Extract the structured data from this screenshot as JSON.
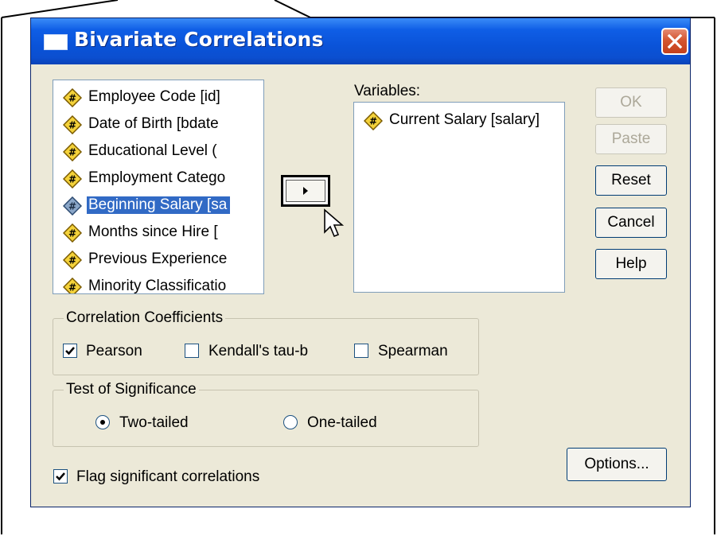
{
  "dialog": {
    "title": "Bivariate Correlations"
  },
  "source_list": {
    "items": [
      {
        "label": "Employee Code [id]",
        "selected": false
      },
      {
        "label": "Date of Birth [bdate",
        "selected": false
      },
      {
        "label": "Educational Level (",
        "selected": false
      },
      {
        "label": "Employment Catego",
        "selected": false
      },
      {
        "label": "Beginning Salary [sa",
        "selected": true
      },
      {
        "label": "Months since Hire [",
        "selected": false
      },
      {
        "label": "Previous Experience",
        "selected": false
      },
      {
        "label": "Minority Classificatio",
        "selected": false
      }
    ]
  },
  "variables": {
    "label": "Variables:",
    "items": [
      {
        "label": "Current Salary [salary]"
      }
    ]
  },
  "buttons": {
    "ok": "OK",
    "paste": "Paste",
    "reset": "Reset",
    "cancel": "Cancel",
    "help": "Help",
    "options": "Options..."
  },
  "correlation_coefficients": {
    "legend": "Correlation Coefficients",
    "pearson": {
      "label": "Pearson",
      "checked": true
    },
    "kendall": {
      "label": "Kendall's tau-b",
      "checked": false
    },
    "spearman": {
      "label": "Spearman",
      "checked": false
    }
  },
  "test_of_significance": {
    "legend": "Test of Significance",
    "two_tailed": {
      "label": "Two-tailed",
      "selected": true
    },
    "one_tailed": {
      "label": "One-tailed",
      "selected": false
    }
  },
  "flag": {
    "label": "Flag significant correlations",
    "checked": true
  },
  "colors": {
    "title_bar": "#0a53d8",
    "dialog_bg": "#ece9d8",
    "selection": "#316ac5",
    "close_button": "#d4552f"
  }
}
